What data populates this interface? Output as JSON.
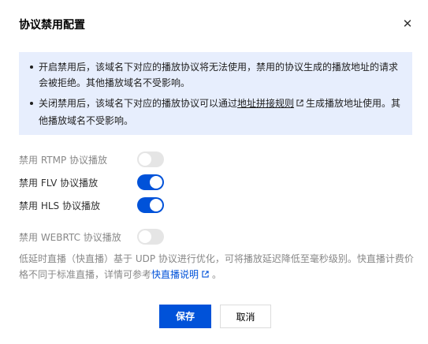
{
  "dialog": {
    "title": "协议禁用配置",
    "close_glyph": "✕"
  },
  "notice": {
    "items": [
      {
        "text": "开启禁用后，该域名下对应的播放协议将无法使用，禁用的协议生成的播放地址的请求会被拒绝。其他播放域名不受影响。"
      },
      {
        "text_before": "关闭禁用后，该域名下对应的播放协议可以通过",
        "link": "地址拼接规则",
        "text_after": "生成播放地址使用。其他播放域名不受影响。"
      }
    ]
  },
  "toggles": [
    {
      "label": "禁用 RTMP 协议播放",
      "enabled": false
    },
    {
      "label": "禁用 FLV 协议播放",
      "enabled": true
    },
    {
      "label": "禁用 HLS 协议播放",
      "enabled": true
    },
    {
      "label": "禁用 WEBRTC 协议播放",
      "enabled": false
    }
  ],
  "description": {
    "text_before": "低延时直播（快直播）基于 UDP 协议进行优化，可将播放延迟降低至毫秒级别。快直播计费价格不同于标准直播，详情可参考",
    "link": "快直播说明",
    "text_after": "。"
  },
  "buttons": {
    "save": "保存",
    "cancel": "取消"
  },
  "colors": {
    "accent": "#0052d9",
    "notice_bg": "#e7eefd",
    "toggle_off": "#e5e5e5"
  },
  "icons": {
    "close": "close-icon",
    "external_link": "external-link-icon"
  }
}
